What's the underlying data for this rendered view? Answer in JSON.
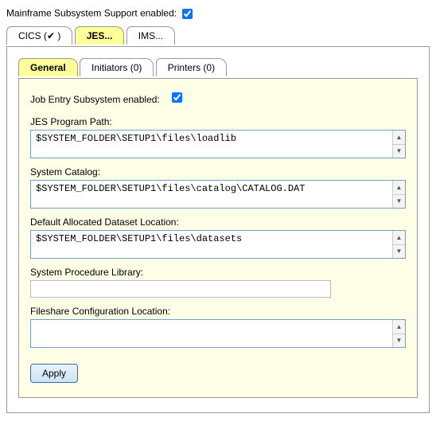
{
  "top": {
    "label": "Mainframe Subsystem Support enabled:",
    "checked": true
  },
  "outerTabs": [
    {
      "label": "CICS (✔ )",
      "active": false
    },
    {
      "label": "JES...",
      "active": true
    },
    {
      "label": "IMS...",
      "active": false
    }
  ],
  "innerTabs": [
    {
      "label": "General",
      "active": true
    },
    {
      "label": "Initiators (0)",
      "active": false
    },
    {
      "label": "Printers (0)",
      "active": false
    }
  ],
  "jes": {
    "enabledLabel": "Job Entry Subsystem enabled:",
    "enabledChecked": true,
    "fields": {
      "programPath": {
        "label": "JES Program Path:",
        "value": "$SYSTEM_FOLDER\\SETUP1\\files\\loadlib"
      },
      "systemCatalog": {
        "label": "System Catalog:",
        "value": "$SYSTEM_FOLDER\\SETUP1\\files\\catalog\\CATALOG.DAT"
      },
      "datasetLoc": {
        "label": "Default Allocated Dataset Location:",
        "value": "$SYSTEM_FOLDER\\SETUP1\\files\\datasets"
      },
      "procLib": {
        "label": "System Procedure Library:",
        "value": ""
      },
      "fileshare": {
        "label": "Fileshare Configuration Location:",
        "value": ""
      }
    },
    "applyLabel": "Apply"
  }
}
